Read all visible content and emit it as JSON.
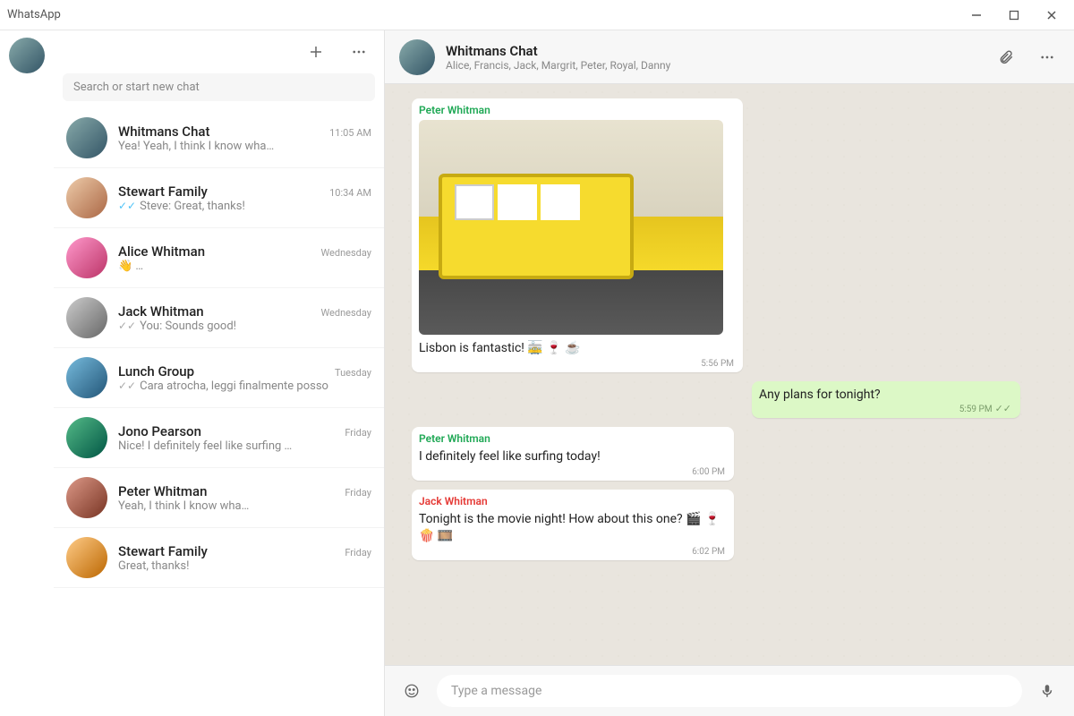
{
  "window": {
    "title": "WhatsApp"
  },
  "sidebar": {
    "new_chat_icon": "plus-icon",
    "menu_icon": "more-icon",
    "search_placeholder": "Search or start new chat",
    "chats": [
      {
        "name": "Whitmans Chat",
        "time": "11:05 AM",
        "preview": "Yea! Yeah, I think I know wha…",
        "ticks": ""
      },
      {
        "name": "Stewart Family",
        "time": "10:34 AM",
        "preview": "Steve: Great, thanks!",
        "ticks": "read"
      },
      {
        "name": "Alice Whitman",
        "time": "Wednesday",
        "preview": "👋 …",
        "ticks": ""
      },
      {
        "name": "Jack Whitman",
        "time": "Wednesday",
        "preview": "You: Sounds good!",
        "ticks": "sent"
      },
      {
        "name": "Lunch Group",
        "time": "Tuesday",
        "preview": "Cara atrocha, leggi finalmente posso",
        "ticks": "sent"
      },
      {
        "name": "Jono Pearson",
        "time": "Friday",
        "preview": "Nice! I definitely feel like surfing …",
        "ticks": ""
      },
      {
        "name": "Peter Whitman",
        "time": "Friday",
        "preview": "Yeah, I think I know wha…",
        "ticks": ""
      },
      {
        "name": "Stewart Family",
        "time": "Friday",
        "preview": "Great, thanks!",
        "ticks": ""
      }
    ]
  },
  "conversation": {
    "title": "Whitmans Chat",
    "subtitle": "Alice, Francis, Jack, Margrit, Peter, Royal, Danny",
    "messages": [
      {
        "kind": "in",
        "sender": "Peter Whitman",
        "sender_class": "peter",
        "has_image": true,
        "text": "Lisbon is fantastic! 🚋 🍷 ☕",
        "time": "5:56 PM"
      },
      {
        "kind": "out",
        "text": "Any plans for tonight?",
        "time": "5:59 PM",
        "ticks": "✓✓"
      },
      {
        "kind": "in",
        "sender": "Peter Whitman",
        "sender_class": "peter",
        "text": "I definitely feel like surfing today!",
        "time": "6:00 PM"
      },
      {
        "kind": "in",
        "sender": "Jack Whitman",
        "sender_class": "jack",
        "text": "Tonight is the movie night! How about this one? 🎬 🍷 🍿 🎞️",
        "time": "6:02 PM"
      }
    ],
    "input_placeholder": "Type a message"
  }
}
